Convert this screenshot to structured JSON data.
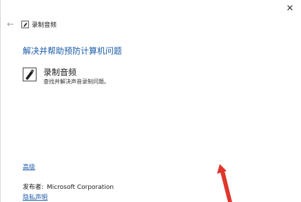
{
  "window": {
    "close_glyph": "✕"
  },
  "nav": {
    "back_glyph": "←",
    "title": "录制音频"
  },
  "main": {
    "heading": "解决并帮助预防计算机问题",
    "item": {
      "title": "录制音频",
      "description": "查找并解决声音录制问题。",
      "icon": "microphone-icon"
    }
  },
  "footer": {
    "advanced_label": "高级",
    "publisher_label": "发布者:",
    "publisher_name": "Microsoft Corporation",
    "privacy_label": "隐私声明"
  },
  "colors": {
    "link": "#1c5ba8",
    "annotation": "#e0362b"
  }
}
